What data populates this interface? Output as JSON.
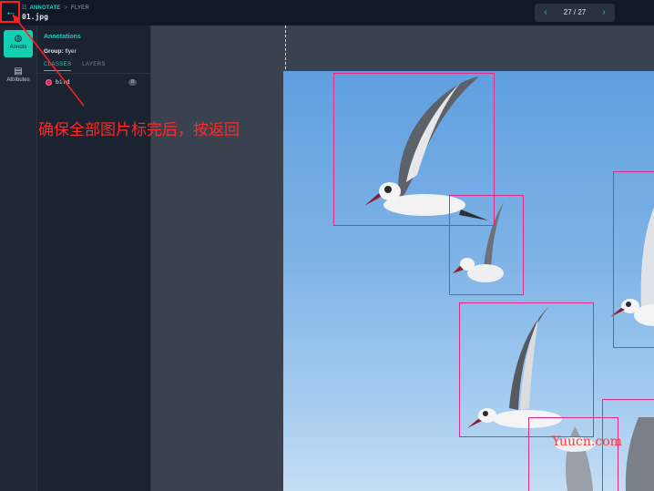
{
  "topbar": {
    "back_icon": "arrow-left-icon",
    "module": "ANNOTATE",
    "breadcrumb_separator": ">",
    "dataset": "FLYER",
    "filename": "01.jpg",
    "pager": {
      "prev": "‹",
      "count": "27 / 27",
      "next": "›"
    }
  },
  "rail": {
    "items": [
      {
        "label": "Annots",
        "icon": "annotation-icon",
        "glyph": "◍",
        "active": true
      },
      {
        "label": "Attributes",
        "icon": "attributes-icon",
        "glyph": "▤",
        "active": false
      }
    ]
  },
  "panel": {
    "title": "Annotations",
    "group_label": "Group:",
    "group_value": "flyer",
    "tabs": [
      "CLASSES",
      "LAYERS"
    ],
    "active_tab": "CLASSES",
    "classes": [
      {
        "name": "bird",
        "count": "8",
        "color": "#e0245e"
      }
    ]
  },
  "overlay": {
    "instruction_text": "确保全部图片标完后，按返回",
    "watermark": "Yuucn.com",
    "accent_color": "#ff1f1f"
  },
  "canvas": {
    "box_color": "#e52a86",
    "sky_color": "#6fa9e3"
  }
}
